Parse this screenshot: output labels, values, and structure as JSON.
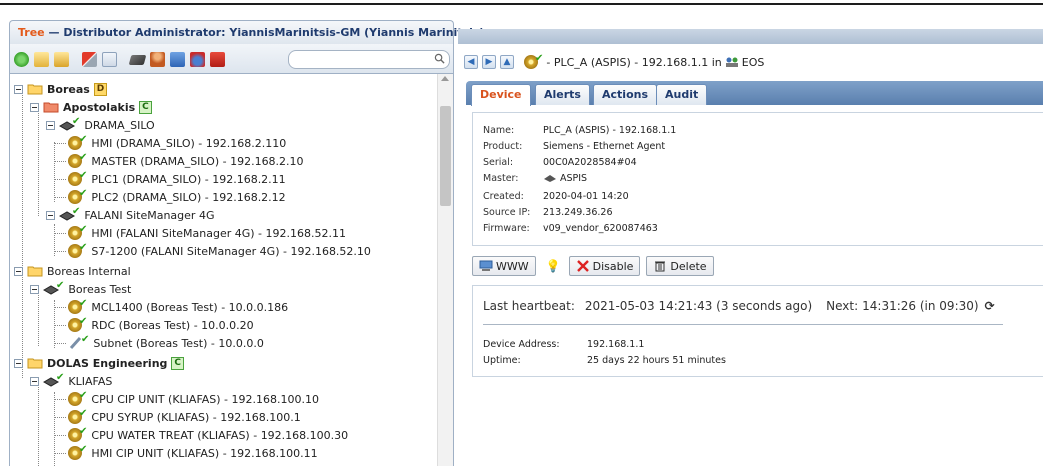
{
  "window": {
    "app_label": "Tree",
    "separator": "—",
    "title": "Distributor Administrator: YiannisMarinitsis-GM (Yiannis Marinitsis)"
  },
  "toolbar": {
    "icons": [
      "refresh-icon",
      "add-domain-icon",
      "add-node-icon",
      "tool-icon",
      "check-icon",
      "device-icon",
      "user-icon",
      "edit-icon",
      "alarm-icon",
      "toolbox-icon"
    ],
    "search_placeholder": ""
  },
  "tree": {
    "rows": [
      {
        "label": "Boreas",
        "bold": true,
        "badge": "D",
        "type": "domain"
      },
      {
        "label": "Apostolakis",
        "bold": true,
        "badge": "C",
        "type": "customer"
      },
      {
        "label": "DRAMA_SILO",
        "type": "site"
      },
      {
        "label": "HMI (DRAMA_SILO) - 192.168.2.110",
        "type": "device"
      },
      {
        "label": "MASTER (DRAMA_SILO) - 192.168.2.10",
        "type": "device"
      },
      {
        "label": "PLC1 (DRAMA_SILO) - 192.168.2.11",
        "type": "device"
      },
      {
        "label": "PLC2 (DRAMA_SILO) - 192.168.2.12",
        "type": "device"
      },
      {
        "label": "FALANI SiteManager 4G",
        "type": "site"
      },
      {
        "label": "HMI (FALANI SiteManager 4G) - 192.168.52.11",
        "type": "device"
      },
      {
        "label": "S7-1200 (FALANI SiteManager 4G) - 192.168.52.10",
        "type": "device"
      },
      {
        "label": "Boreas Internal",
        "type": "folder"
      },
      {
        "label": "Boreas Test",
        "type": "site"
      },
      {
        "label": "MCL1400 (Boreas Test) - 10.0.0.186",
        "type": "device"
      },
      {
        "label": "RDC (Boreas Test) - 10.0.0.20",
        "type": "device"
      },
      {
        "label": "Subnet (Boreas Test) - 10.0.0.0",
        "type": "subnet"
      },
      {
        "label": "DOLAS Engineering",
        "bold": true,
        "badge": "C",
        "type": "folder"
      },
      {
        "label": "KLIAFAS",
        "type": "site"
      },
      {
        "label": "CPU CIP UNIT (KLIAFAS) - 192.168.100.10",
        "type": "device"
      },
      {
        "label": "CPU SYRUP (KLIAFAS) - 192.168.100.1",
        "type": "device"
      },
      {
        "label": "CPU WATER TREAT (KLIAFAS) - 192.168.100.30",
        "type": "device"
      },
      {
        "label": "HMI CIP UNIT (KLIAFAS) - 192.168.100.11",
        "type": "device"
      }
    ]
  },
  "breadcrumb": {
    "text": "- PLC_A (ASPIS) - 192.168.1.1 in",
    "group": "EOS"
  },
  "tabs": [
    "Device",
    "Alerts",
    "Actions",
    "Audit"
  ],
  "device": {
    "fields": [
      {
        "key": "Name:",
        "value": "PLC_A (ASPIS) - 192.168.1.1"
      },
      {
        "key": "Product:",
        "value": "Siemens - Ethernet Agent"
      },
      {
        "key": "Serial:",
        "value": "00C0A2028584#04"
      },
      {
        "key": "Master:",
        "value": "ASPIS"
      },
      {
        "key": "Created:",
        "value": "2020-04-01 14:20"
      },
      {
        "key": "Source IP:",
        "value": "213.249.36.26"
      },
      {
        "key": "Firmware:",
        "value": "v09_vendor_620087463"
      }
    ]
  },
  "actions": {
    "www": "WWW",
    "disable": "Disable",
    "delete": "Delete"
  },
  "heartbeat": {
    "label": "Last heartbeat:",
    "value": "2021-05-03 14:21:43 (3 seconds ago)",
    "next_label": "Next:",
    "next_value": "14:31:26 (in 09:30)",
    "address_label": "Device Address:",
    "address_value": "192.168.1.1",
    "uptime_label": "Uptime:",
    "uptime_value": "25 days 22 hours 51 minutes"
  }
}
